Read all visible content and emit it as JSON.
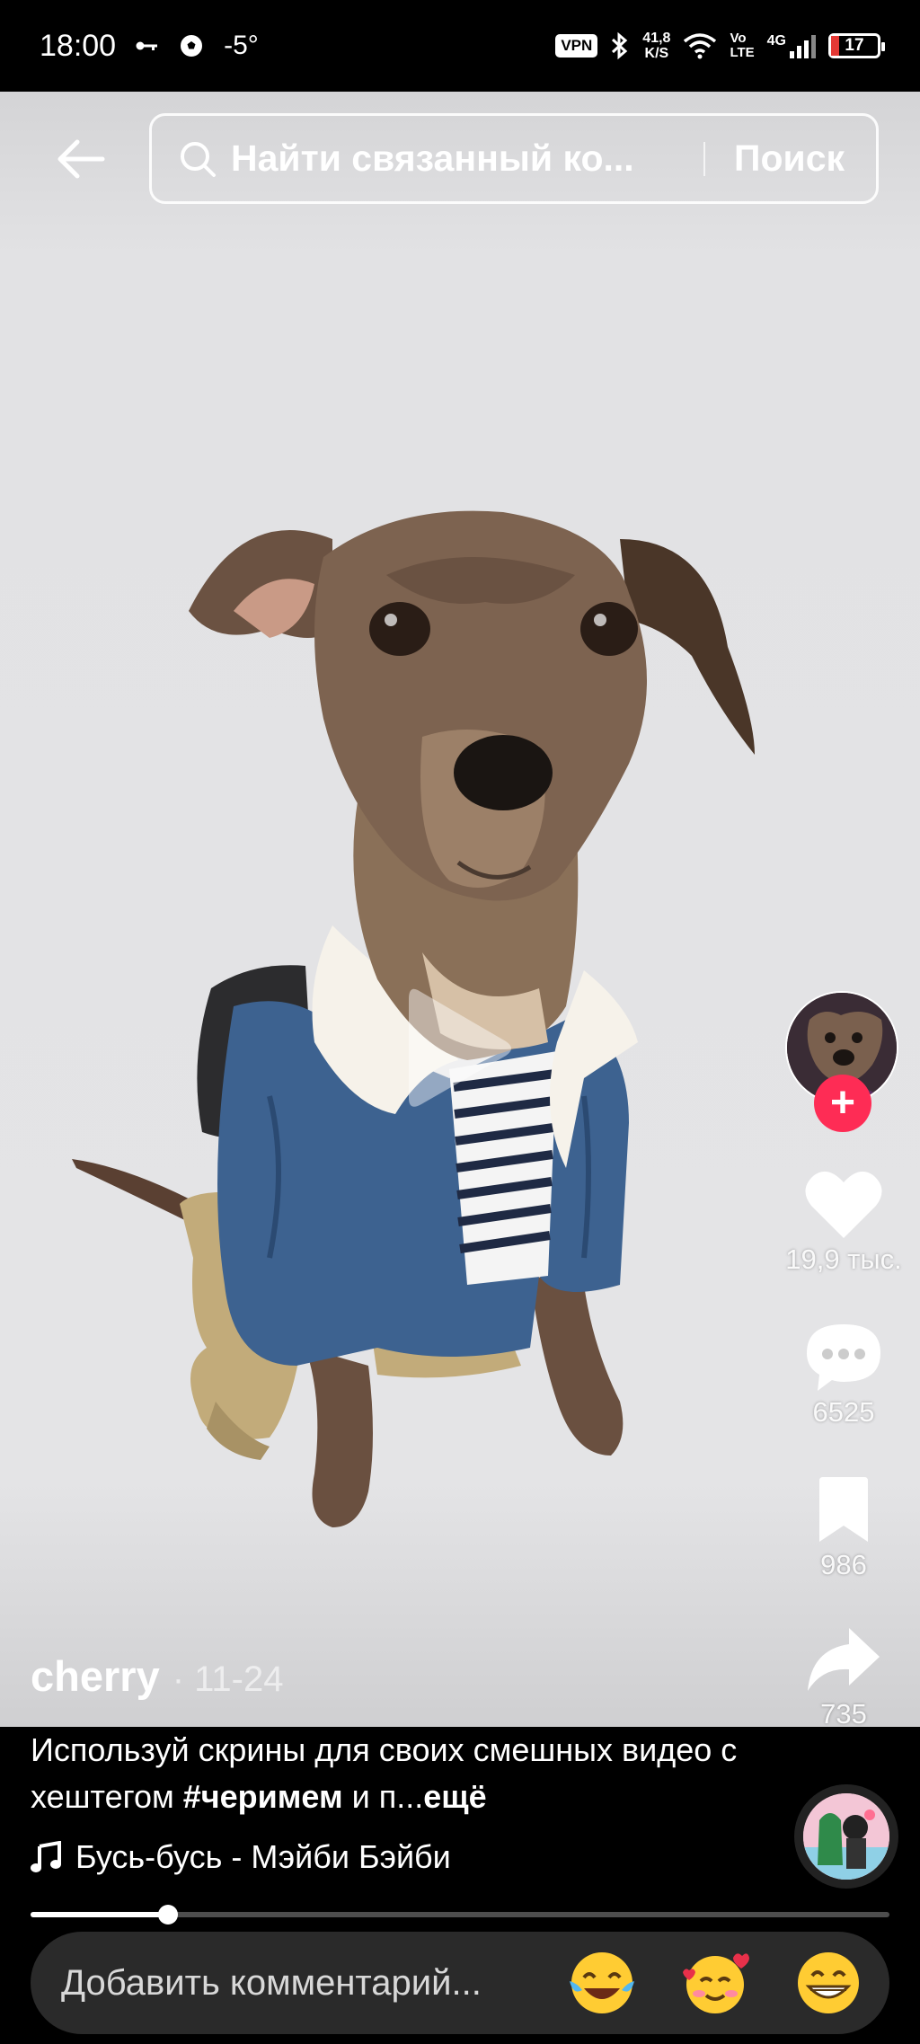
{
  "status_bar": {
    "time": "18:00",
    "temperature": "-5°",
    "vpn": "VPN",
    "speed_value": "41,8",
    "speed_unit": "K/S",
    "volte_top": "Vo",
    "volte_bottom": "LTE",
    "network": "4G",
    "battery": "17"
  },
  "search": {
    "placeholder": "Найти связанный ко...",
    "submit_label": "Поиск"
  },
  "rail": {
    "likes": "19,9 тыс.",
    "comments": "6525",
    "favorites": "986",
    "shares": "735"
  },
  "post": {
    "author": "cherry",
    "date": "· 11-24",
    "description_prefix": "Используй скрины для своих смешных видео с хештегом ",
    "hashtag": "#черимем",
    "description_suffix": " и п...",
    "more_label": "ещё",
    "music": "Бусь-бусь - Мэйби Бэйби"
  },
  "progress": {
    "fraction": 0.16
  },
  "comment_bar": {
    "placeholder": "Добавить комментарий..."
  },
  "icons": [
    "back-arrow-icon",
    "search-icon",
    "play-icon",
    "heart-icon",
    "comment-icon",
    "bookmark-icon",
    "share-icon",
    "music-note-icon"
  ],
  "colors": {
    "accent": "#fe2c55",
    "background": "#000000",
    "video_bg": "#e3e3e5"
  }
}
